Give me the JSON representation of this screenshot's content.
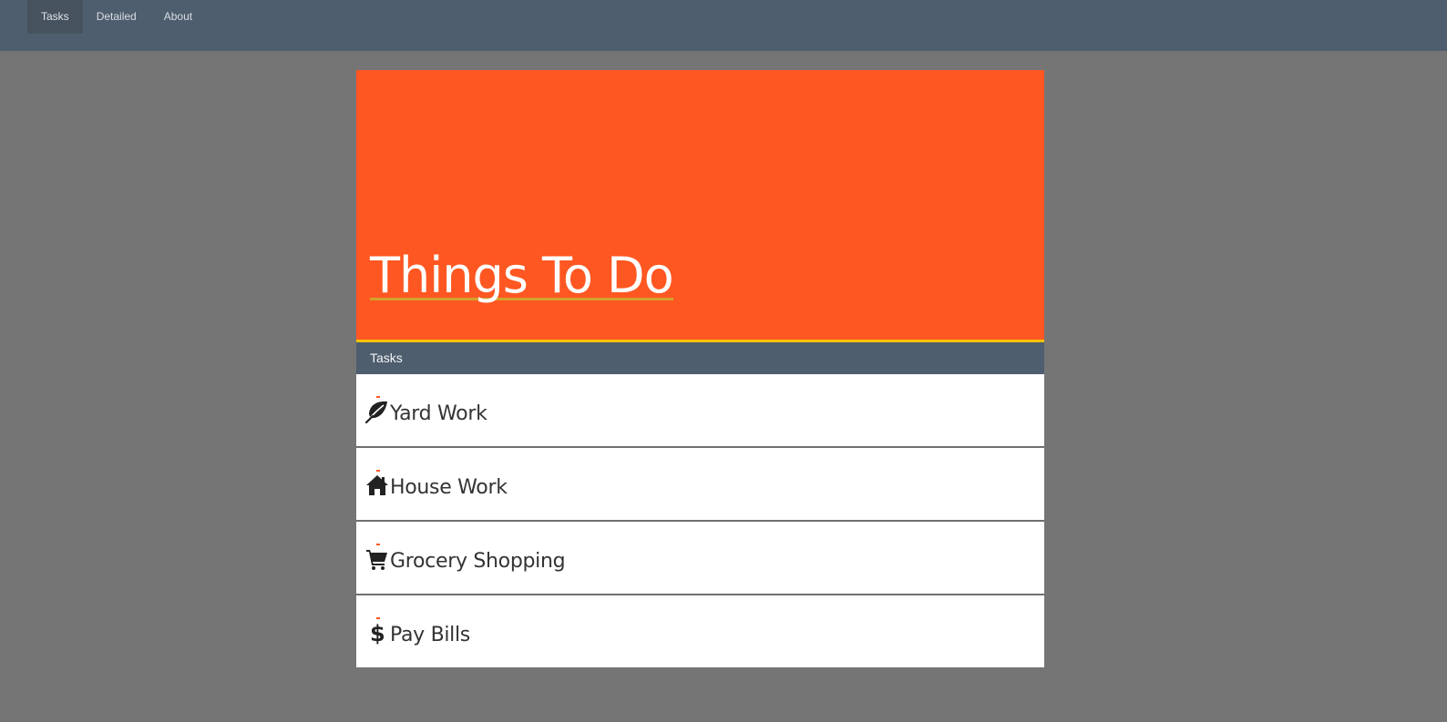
{
  "nav": {
    "items": [
      {
        "label": "Tasks",
        "active": true
      },
      {
        "label": "Detailed",
        "active": false
      },
      {
        "label": "About",
        "active": false
      }
    ]
  },
  "hero": {
    "title": "Things To Do",
    "background_color": "#ff5722",
    "accent_color": "#ffc107"
  },
  "section": {
    "title": "Tasks"
  },
  "tasks": [
    {
      "label": "Yard Work",
      "icon": "leaf-icon"
    },
    {
      "label": "House Work",
      "icon": "home-icon"
    },
    {
      "label": "Grocery Shopping",
      "icon": "shopping-cart-icon"
    },
    {
      "label": "Pay Bills",
      "icon": "dollar-icon"
    }
  ]
}
